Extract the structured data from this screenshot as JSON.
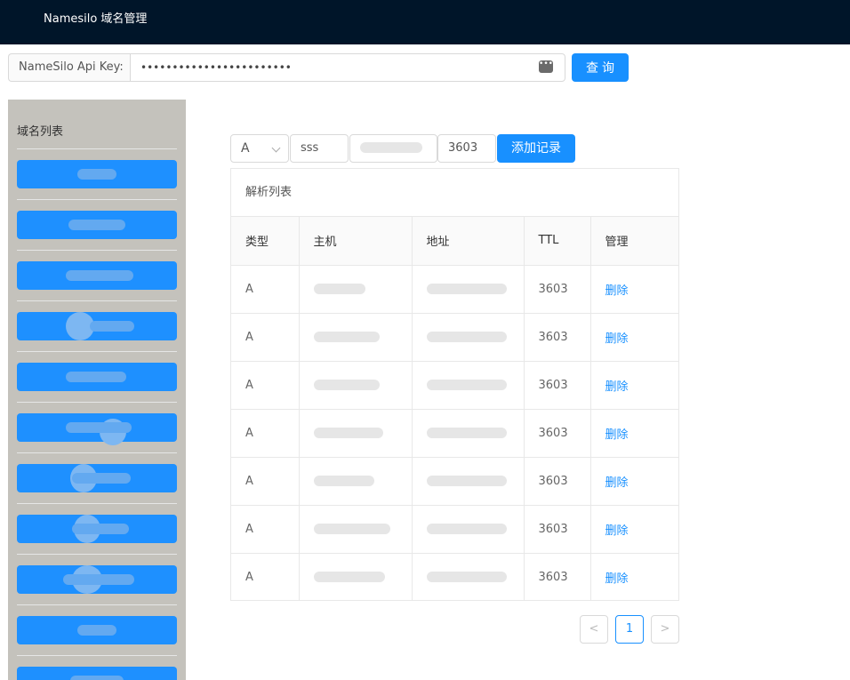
{
  "header": {
    "title": "Namesilo 域名管理"
  },
  "apikey": {
    "label": "NameSilo Api Key:",
    "value": "••••••••••••••••••••••••",
    "query_label": "查询"
  },
  "sidebar": {
    "heading": "域名列表",
    "domain_count": 11
  },
  "record_form": {
    "type_value": "A",
    "host_value": "sss",
    "ttl_value": "3603",
    "add_label": "添加记录"
  },
  "records": {
    "title": "解析列表",
    "columns": [
      "类型",
      "主机",
      "地址",
      "TTL",
      "管理"
    ],
    "rows": [
      {
        "type": "A",
        "ttl": "3603",
        "action": "删除"
      },
      {
        "type": "A",
        "ttl": "3603",
        "action": "删除"
      },
      {
        "type": "A",
        "ttl": "3603",
        "action": "删除"
      },
      {
        "type": "A",
        "ttl": "3603",
        "action": "删除"
      },
      {
        "type": "A",
        "ttl": "3603",
        "action": "删除"
      },
      {
        "type": "A",
        "ttl": "3603",
        "action": "删除"
      },
      {
        "type": "A",
        "ttl": "3603",
        "action": "删除"
      }
    ]
  },
  "pagination": {
    "prev": "<",
    "current": "1",
    "next": ">"
  },
  "colors": {
    "header_bg": "#001529",
    "primary": "#1890ff",
    "sidebar_bg": "#c4c2bc"
  }
}
